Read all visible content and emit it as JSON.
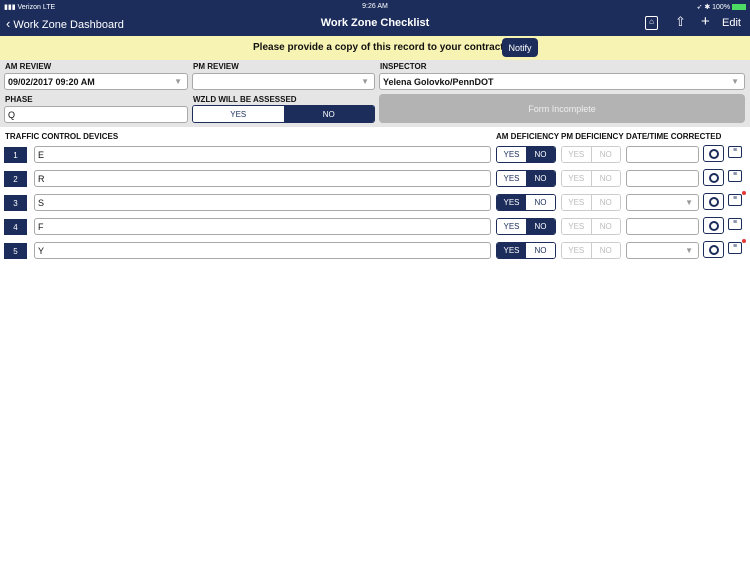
{
  "status_bar": {
    "carrier": "Verizon",
    "network": "LTE",
    "time": "9:26 AM",
    "battery": "100%"
  },
  "nav": {
    "back_label": "Work Zone Dashboard",
    "title": "Work Zone Checklist",
    "edit_label": "Edit",
    "icons": [
      "house-document-icon",
      "share-icon",
      "plus-icon"
    ]
  },
  "banner": {
    "message": "Please provide a copy of this record to your contractor.",
    "notify_label": "Notify"
  },
  "form": {
    "am_review_label": "AM REVIEW",
    "am_review_value": "09/02/2017 09:20 AM",
    "pm_review_label": "PM REVIEW",
    "pm_review_value": "",
    "inspector_label": "INSPECTOR",
    "inspector_value": "Yelena Golovko/PennDOT",
    "phase_label": "PHASE",
    "phase_value": "Q",
    "wzld_label": "WZLD WILL BE ASSESSED",
    "wzld_yes": "YES",
    "wzld_no": "NO",
    "wzld_selected": "NO",
    "form_status": "Form Incomplete"
  },
  "table": {
    "headers": {
      "devices": "TRAFFIC CONTROL DEVICES",
      "am": "AM DEFICIENCY",
      "pm": "PM DEFICIENCY",
      "date": "DATE/TIME CORRECTED"
    },
    "yes": "YES",
    "no": "NO",
    "rows": [
      {
        "num": "1",
        "value": "E",
        "am": "NO",
        "date_dropdown": false,
        "comment_flag": false
      },
      {
        "num": "2",
        "value": "R",
        "am": "NO",
        "date_dropdown": false,
        "comment_flag": false
      },
      {
        "num": "3",
        "value": "S",
        "am": "YES",
        "date_dropdown": true,
        "comment_flag": true
      },
      {
        "num": "4",
        "value": "F",
        "am": "NO",
        "date_dropdown": false,
        "comment_flag": false
      },
      {
        "num": "5",
        "value": "Y",
        "am": "YES",
        "date_dropdown": true,
        "comment_flag": true
      }
    ]
  },
  "colors": {
    "primary": "#1c2d5c",
    "banner": "#f7f3b2",
    "flag": "#e53935"
  }
}
